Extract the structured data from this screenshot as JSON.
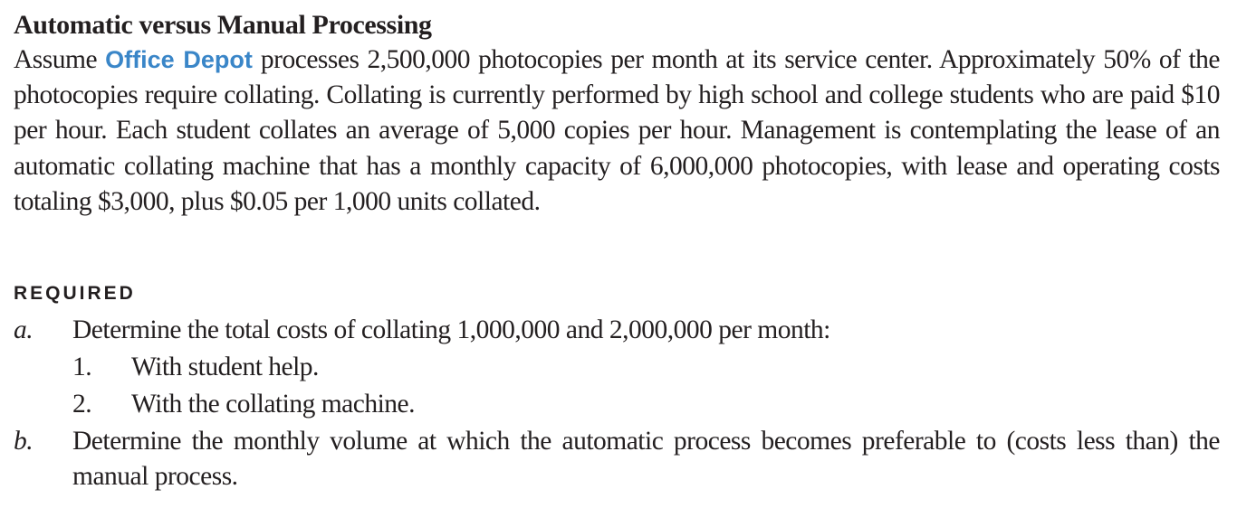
{
  "title": "Automatic versus Manual Processing",
  "intro": {
    "prefix": "Assume",
    "brand": "Office Depot",
    "body": "processes 2,500,000 photocopies per month at its service center. Approximately 50% of the photocopies require collating. Collating is currently performed by high school and college students who are paid $10 per hour. Each student collates an average of 5,000 copies per hour. Management is contemplating the lease of an automatic collating machine that has a monthly capacity of 6,000,000 photocopies, with lease and operating costs totaling $3,000, plus $0.05 per 1,000 units collated."
  },
  "brand_color": "#3a86c8",
  "required": {
    "heading": "REQUIRED",
    "items": [
      {
        "marker": "a.",
        "text": "Determine the total costs of collating 1,000,000 and 2,000,000 per month:",
        "subitems": [
          {
            "marker": "1.",
            "text": "With student help."
          },
          {
            "marker": "2.",
            "text": "With the collating machine."
          }
        ]
      },
      {
        "marker": "b.",
        "text": "Determine the monthly volume at which the automatic process becomes preferable to (costs less than) the manual process."
      }
    ]
  }
}
